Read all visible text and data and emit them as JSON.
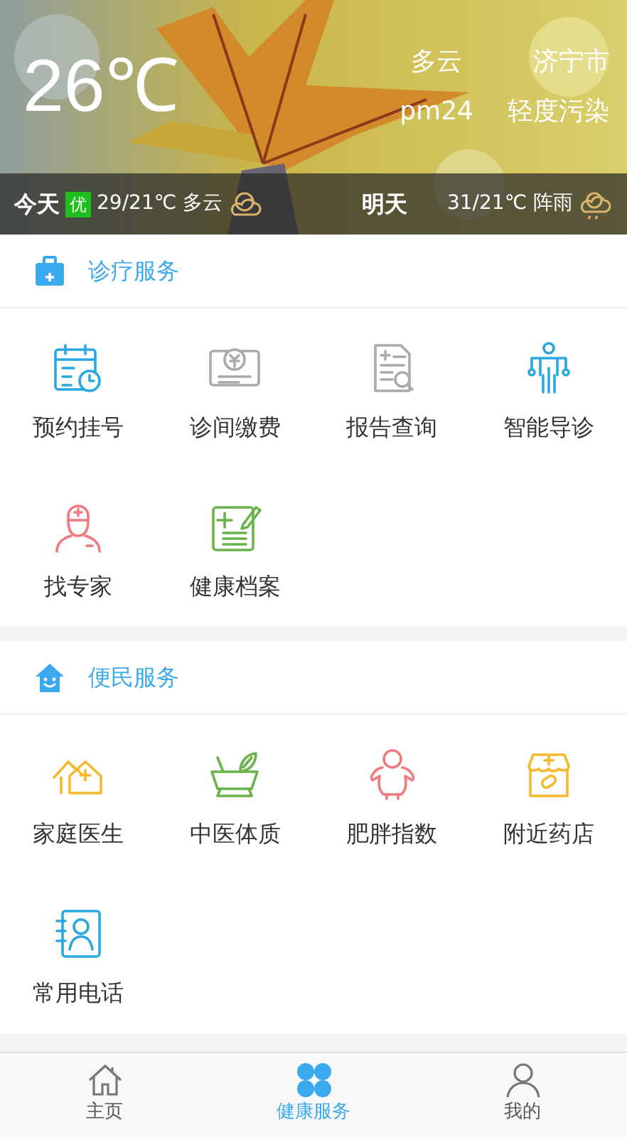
{
  "weather": {
    "temperature": "26℃",
    "condition": "多云",
    "city": "济宁市",
    "pm_label": "pm24",
    "air_quality": "轻度污染",
    "today": {
      "label": "今天",
      "aqi_badge": "优",
      "forecast": "29/21℃ 多云"
    },
    "tomorrow": {
      "label": "明天",
      "forecast": "31/21℃ 阵雨"
    }
  },
  "sections": [
    {
      "title": "诊疗服务",
      "items": [
        {
          "label": "预约挂号"
        },
        {
          "label": "诊间缴费"
        },
        {
          "label": "报告查询"
        },
        {
          "label": "智能导诊"
        },
        {
          "label": "找专家"
        },
        {
          "label": "健康档案"
        }
      ]
    },
    {
      "title": "便民服务",
      "items": [
        {
          "label": "家庭医生"
        },
        {
          "label": "中医体质"
        },
        {
          "label": "肥胖指数"
        },
        {
          "label": "附近药店"
        },
        {
          "label": "常用电话"
        }
      ]
    }
  ],
  "tab_bar": [
    {
      "label": "主页",
      "selected": false
    },
    {
      "label": "健康服务",
      "selected": true
    },
    {
      "label": "我的",
      "selected": false
    }
  ]
}
